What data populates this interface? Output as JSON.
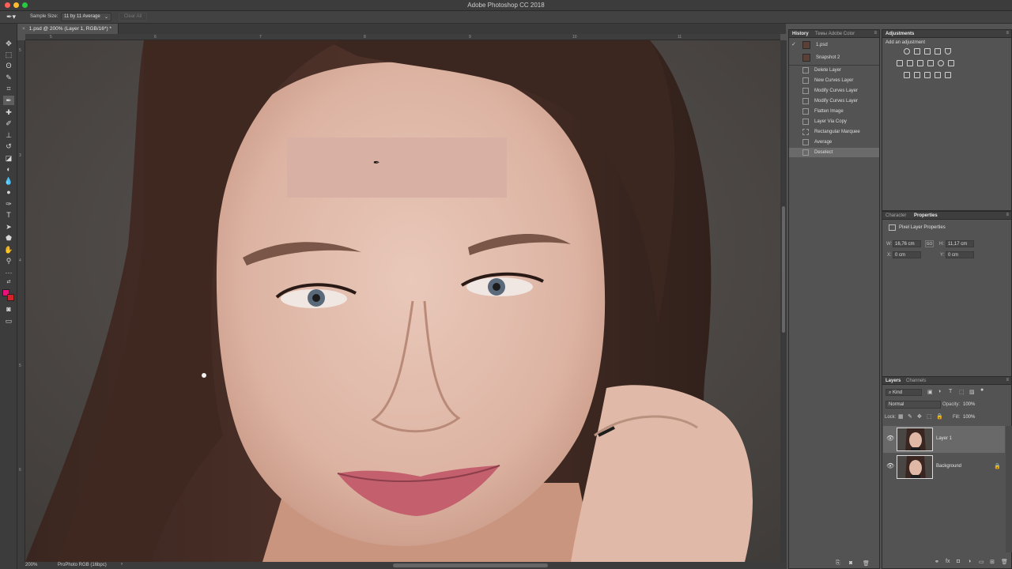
{
  "window": {
    "app_title": "Adobe Photoshop CC 2018",
    "traffic_lights": [
      "#fe5f57",
      "#febc2e",
      "#28c840"
    ]
  },
  "options_bar": {
    "sample_size_label": "Sample Size:",
    "sample_size_value": "11 by 11 Average",
    "clear_all": "Clear All"
  },
  "document": {
    "tab_title": "1.psd @ 200% (Layer 1, RGB/16*) *",
    "close_glyph": "×",
    "zoom": "200%",
    "color_profile": "ProPhoto RGB (16bpc)",
    "status_chevron": "›"
  },
  "rulers": {
    "top_ticks": [
      "5",
      "6",
      "7",
      "8",
      "9",
      "10",
      "11"
    ],
    "left_ticks": [
      "5",
      "3",
      "4",
      "5",
      "6"
    ]
  },
  "colors": {
    "foreground": "#e8127a",
    "background": "#d2232a",
    "sample_patch": "#d9b1a4"
  },
  "history": {
    "tabs": [
      "History",
      "Темы Adobe Color"
    ],
    "snapshots": [
      {
        "label": "1.psd"
      },
      {
        "label": "Snapshot 2"
      }
    ],
    "items": [
      {
        "label": "Delete Layer"
      },
      {
        "label": "New Curves Layer"
      },
      {
        "label": "Modify Curves Layer"
      },
      {
        "label": "Modify Curves Layer"
      },
      {
        "label": "Flatten Image"
      },
      {
        "label": "Layer Via Copy"
      },
      {
        "label": "Rectangular Marquee"
      },
      {
        "label": "Average"
      },
      {
        "label": "Deselect"
      }
    ]
  },
  "adjustments": {
    "tab": "Adjustments",
    "subtitle": "Add an adjustment"
  },
  "properties": {
    "tabs": [
      "Character",
      "Properties"
    ],
    "title": "Pixel Layer Properties",
    "w_label": "W:",
    "w_value": "16,76 cm",
    "link_label": "GO",
    "h_label": "H:",
    "h_value": "11,17 cm",
    "x_label": "X:",
    "x_value": "0 cm",
    "y_label": "Y:",
    "y_value": "0 cm"
  },
  "layers": {
    "tabs": [
      "Layers",
      "Channels"
    ],
    "filter": "Kind",
    "blend_mode": "Normal",
    "opacity_label": "Opacity:",
    "opacity_value": "100%",
    "lock_label": "Lock:",
    "fill_label": "Fill:",
    "fill_value": "100%",
    "items": [
      {
        "name": "Layer 1"
      },
      {
        "name": "Background"
      }
    ]
  }
}
